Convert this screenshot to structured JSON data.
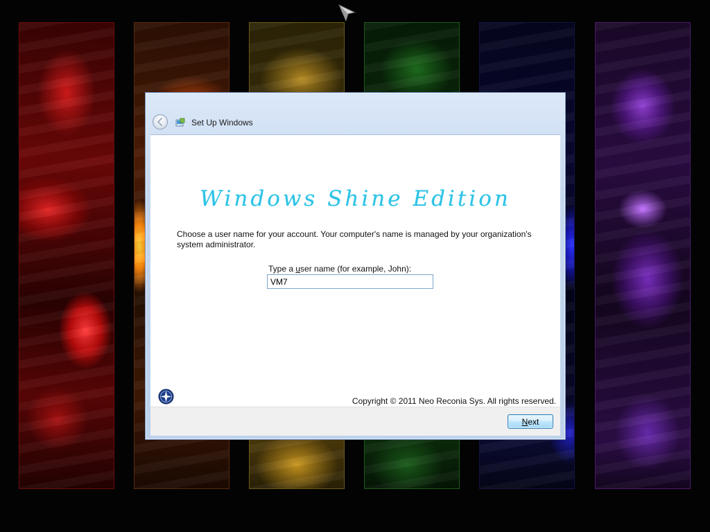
{
  "window": {
    "title": "Set Up Windows"
  },
  "content": {
    "heading": "Windows Shine Edition",
    "description": "Choose a user name for your account.  Your computer's name is managed by your organization's system administrator.",
    "username_label_pre": "Type a ",
    "username_label_key": "u",
    "username_label_post": "ser name (for example, John):",
    "username_value": "VM7",
    "copyright": "Copyright © 2011 Neo Reconia Sys.  All rights reserved."
  },
  "footer": {
    "next_key": "N",
    "next_rest": "ext"
  },
  "icons": {
    "back": "back-arrow-icon",
    "setup": "setup-windows-icon",
    "logo": "compass-logo-icon",
    "cursor": "mouse-pointer-icon"
  },
  "colors": {
    "heading": "#2ec3e6",
    "titlebar": "#c4d7ef",
    "button_border": "#3c7fb1"
  }
}
